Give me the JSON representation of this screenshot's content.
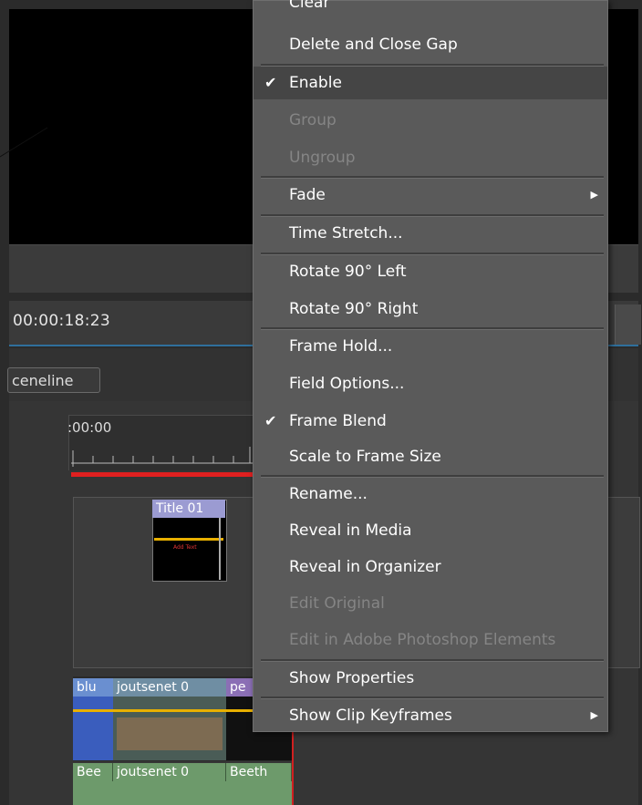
{
  "player": {
    "timecode": "00:00:18:23"
  },
  "tabs": {
    "sceneline": "ceneline"
  },
  "timeline": {
    "ruler_label": ":00:00",
    "title_clip": {
      "label": "Title 01",
      "text": "Add Text"
    },
    "video_clips": [
      "blu",
      "joutsenet 0",
      "pe"
    ],
    "audio_clips": [
      "Bee",
      "joutsenet 0",
      "Beeth"
    ]
  },
  "context_menu": {
    "items": [
      {
        "label": "Clear",
        "enabled": true
      },
      {
        "label": "Delete and Close Gap",
        "enabled": true
      },
      {
        "label": "Enable",
        "enabled": true,
        "checked": true,
        "highlighted": true
      },
      {
        "label": "Group",
        "enabled": false
      },
      {
        "label": "Ungroup",
        "enabled": false
      },
      {
        "label": "Fade",
        "enabled": true,
        "submenu": true
      },
      {
        "label": "Time Stretch...",
        "enabled": true
      },
      {
        "label": "Rotate 90° Left",
        "enabled": true
      },
      {
        "label": "Rotate 90° Right",
        "enabled": true
      },
      {
        "label": "Frame Hold...",
        "enabled": true
      },
      {
        "label": "Field Options...",
        "enabled": true
      },
      {
        "label": "Frame Blend",
        "enabled": true,
        "checked": true
      },
      {
        "label": "Scale to Frame Size",
        "enabled": true
      },
      {
        "label": "Rename...",
        "enabled": true
      },
      {
        "label": "Reveal in Media",
        "enabled": true
      },
      {
        "label": "Reveal in Organizer",
        "enabled": true
      },
      {
        "label": "Edit Original",
        "enabled": false
      },
      {
        "label": "Edit in Adobe Photoshop Elements",
        "enabled": false
      },
      {
        "label": "Show Properties",
        "enabled": true
      },
      {
        "label": "Show Clip Keyframes",
        "enabled": true,
        "submenu": true
      }
    ]
  },
  "icons": {
    "check": "checkmark-icon",
    "submenu": "submenu-arrow-icon"
  }
}
